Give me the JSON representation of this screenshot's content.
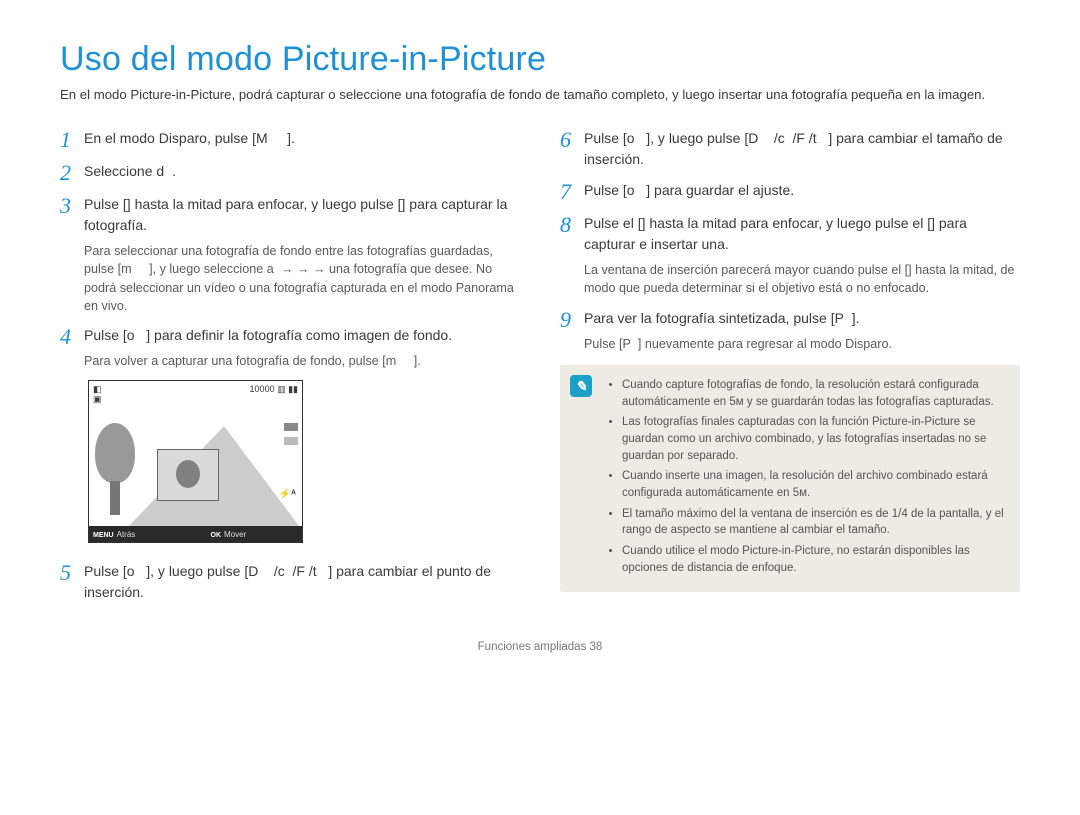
{
  "title": "Uso del modo Picture-in-Picture",
  "intro": "En el modo Picture-in-Picture, podrá capturar o seleccione una fotografía de fondo de tamaño completo, y luego insertar una fotografía pequeña en la imagen.",
  "left_steps": [
    {
      "num": "1",
      "text": "En el modo Disparo, pulse [M     ]."
    },
    {
      "num": "2",
      "text": "Seleccione d  ."
    },
    {
      "num": "3",
      "text": "Pulse [] hasta la mitad para enfocar, y luego pulse [] para capturar la fotografía.",
      "note": "Para seleccionar una fotografía de fondo entre las fotografías guardadas, pulse [m     ], y luego seleccione a  → → → una fotografía que desee. No podrá seleccionar un vídeo o una fotografía capturada en el modo Panorama en vivo."
    },
    {
      "num": "4",
      "text": "Pulse [o   ] para definir la fotografía como imagen de fondo.",
      "note": "Para volver a capturar una fotografía de fondo, pulse [m     ]."
    },
    {
      "num": "5",
      "text": "Pulse [o   ], y luego pulse [D    /c  /F /t   ] para cambiar el punto de inserción."
    }
  ],
  "right_steps": [
    {
      "num": "6",
      "text": "Pulse [o   ], y luego pulse [D    /c  /F /t   ] para cambiar el tamaño de inserción."
    },
    {
      "num": "7",
      "text": "Pulse [o   ] para guardar el ajuste."
    },
    {
      "num": "8",
      "text": "Pulse el [] hasta la mitad para enfocar, y luego pulse el [] para capturar e insertar una.",
      "note": "La ventana de inserción parecerá mayor cuando pulse el [] hasta la mitad, de modo que pueda determinar si el objetivo está o no enfocado."
    },
    {
      "num": "9",
      "text": "Para ver la fotografía sintetizada, pulse [P  ].",
      "note": "Pulse [P  ] nuevamente para regresar al modo Disparo."
    }
  ],
  "diagram": {
    "shots": "10000",
    "back_label": "Atrás",
    "back_btn": "MENU",
    "move_label": "Mover",
    "move_btn": "OK",
    "flash": "⚡ᴬ"
  },
  "infobox_items": [
    "Cuando capture fotografías de fondo, la resolución estará configurada automáticamente en 5ᴍ y se guardarán todas las fotografías capturadas.",
    "Las fotografías finales capturadas con la función Picture-in-Picture se guardan como un archivo combinado, y las fotografías insertadas no se guardan por separado.",
    "Cuando inserte una imagen, la resolución del archivo combinado estará configurada automáticamente en 5ᴍ.",
    "El tamaño máximo del la ventana de inserción es de 1/4 de la pantalla, y el rango de aspecto se mantiene al cambiar el tamaño.",
    "Cuando utilice el modo Picture-in-Picture, no estarán disponibles las opciones de distancia de enfoque."
  ],
  "footer": "Funciones ampliadas  38"
}
